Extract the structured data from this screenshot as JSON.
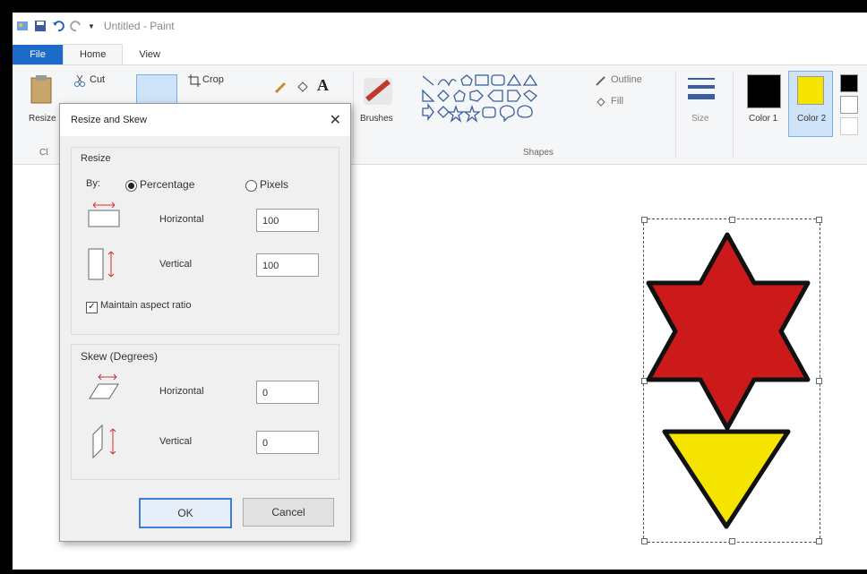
{
  "app": {
    "title": "Untitled - Paint"
  },
  "tabs": [
    {
      "label": "File"
    },
    {
      "label": "Home"
    },
    {
      "label": "View"
    }
  ],
  "ribbon": {
    "resize_label": "Resize",
    "cut_label": "Cut",
    "crop_label": "Crop",
    "brushes_label": "Brushes",
    "outline_label": "Outline",
    "fill_label": "Fill",
    "size_label": "Size",
    "color1_label": "Color 1",
    "color2_label": "Color 2",
    "shapes_group_label": "Shapes",
    "clipboard_group_label": "Cl"
  },
  "dialog": {
    "title": "Resize and Skew",
    "resize_section": "Resize",
    "by_label": "By:",
    "percentage_label": "Percentage",
    "pixels_label": "Pixels",
    "horizontal_label": "Horizontal",
    "vertical_label": "Vertical",
    "horizontal_value": "100",
    "vertical_value": "100",
    "maintain_aspect_label": "Maintain aspect ratio",
    "skew_section": "Skew (Degrees)",
    "skew_horizontal_label": "Horizontal",
    "skew_vertical_label": "Vertical",
    "skew_horizontal_value": "0",
    "skew_vertical_value": "0",
    "ok_label": "OK",
    "cancel_label": "Cancel"
  },
  "colors": {
    "color1": "#000000",
    "color2": "#f5e400",
    "star_fill": "#cc1a1a",
    "triangle_fill": "#f5e400",
    "accent": "#1e6ac8"
  }
}
